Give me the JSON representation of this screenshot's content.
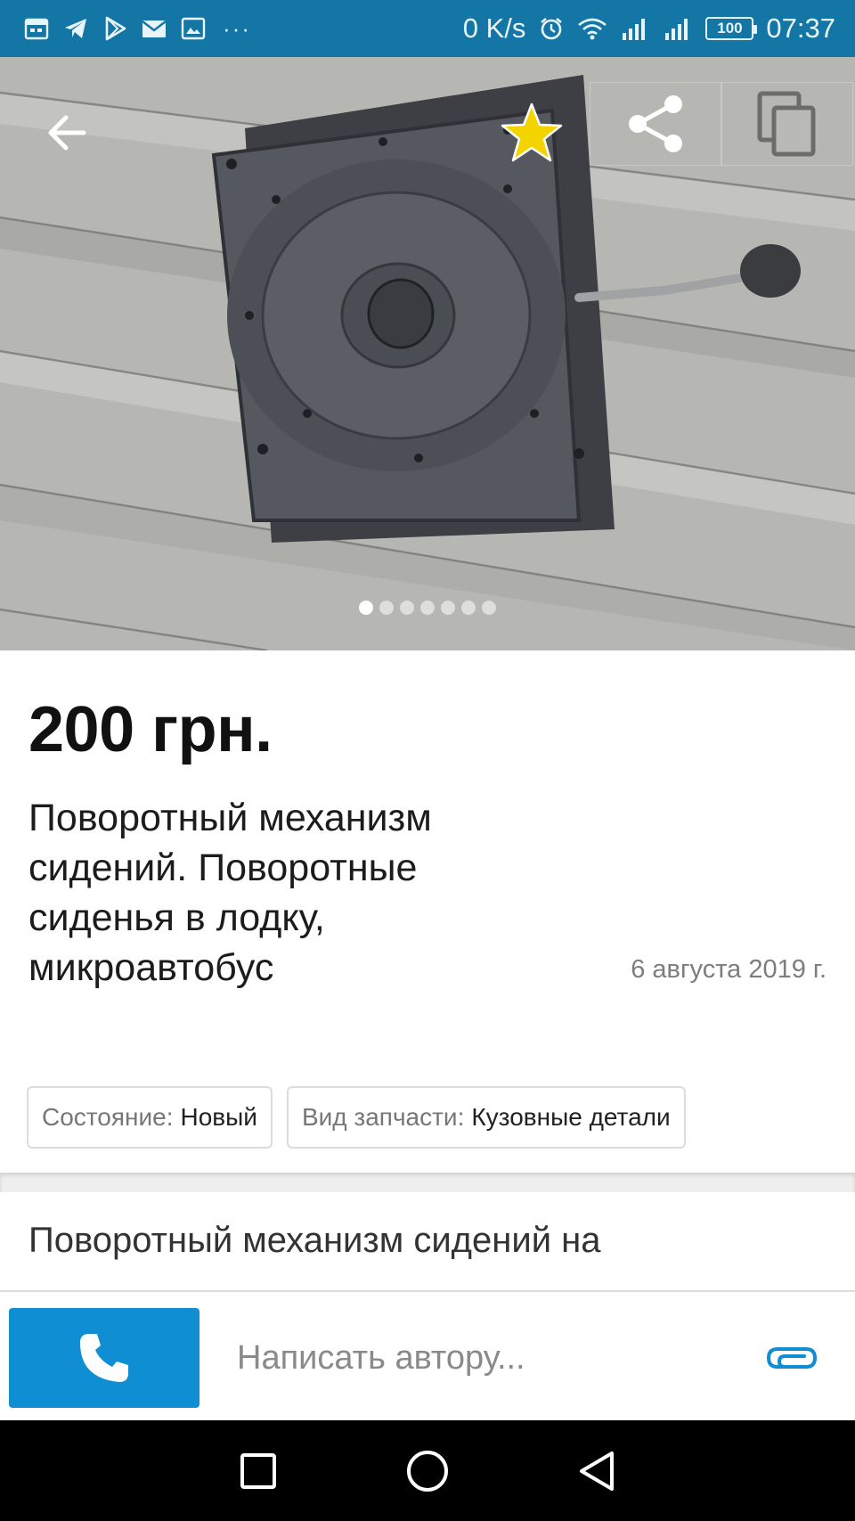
{
  "status_bar": {
    "network_speed": "0 K/s",
    "battery": "100",
    "time": "07:37",
    "overflow": "···",
    "icons": [
      "calendar-icon",
      "telegram-icon",
      "play-store-icon",
      "mail-icon",
      "gallery-icon",
      "alarm-icon",
      "wifi-icon",
      "signal-icon",
      "signal-icon",
      "battery-icon"
    ]
  },
  "gallery": {
    "image_count": 7,
    "active_index": 0,
    "icons": [
      "arrow-left-icon",
      "star-icon",
      "share-icon",
      "copy-icon"
    ]
  },
  "listing": {
    "price": "200 грн.",
    "title": "Поворотный механизм сидений. Поворотные сиденья в лодку, микроавтобус",
    "date": "6 августа 2019 г.",
    "attributes": [
      {
        "key": "Состояние:",
        "value": "Новый"
      },
      {
        "key": "Вид запчасти:",
        "value": "Кузовные детали"
      }
    ],
    "description_preview": "Поворотный механизм сидений на"
  },
  "message_bar": {
    "placeholder": "Написать автору...",
    "icons": [
      "phone-icon",
      "paperclip-icon"
    ]
  },
  "colors": {
    "status_bar": "#1376a5",
    "call_button": "#0f8ed3",
    "favorite_star": "#f4d400",
    "attach_icon": "#0f8ed3"
  },
  "nav_bar": {
    "icons": [
      "recents-icon",
      "home-icon",
      "back-icon"
    ]
  }
}
